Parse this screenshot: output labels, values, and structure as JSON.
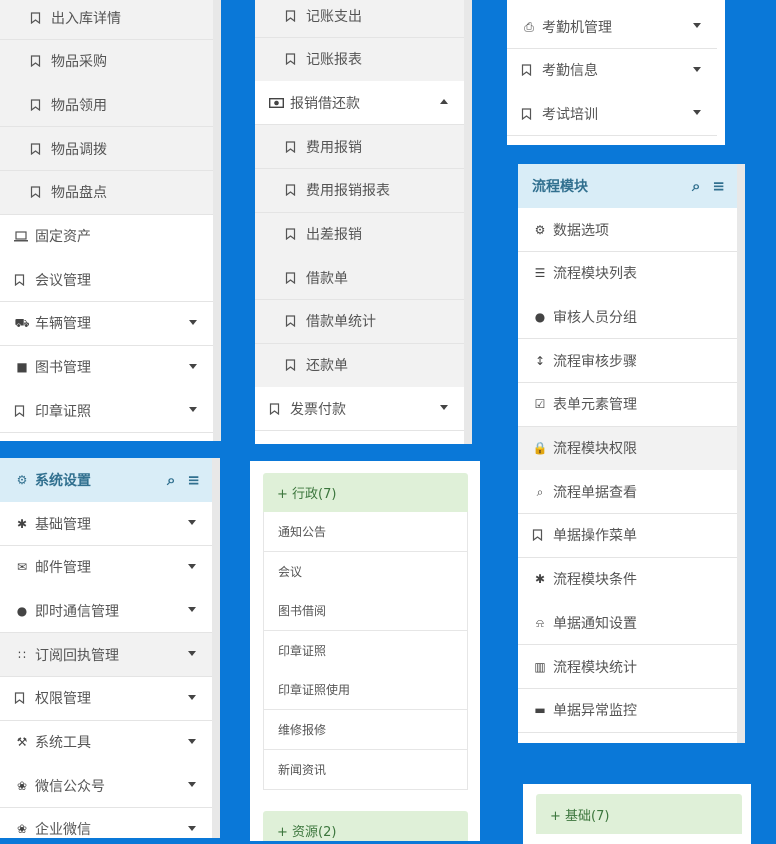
{
  "colors": {
    "background": "#0a78d8",
    "header_blue": "#d9edf7",
    "header_blue_text": "#31708f",
    "header_green": "#dff0d8",
    "header_green_text": "#3c763d"
  },
  "panel_stock": {
    "items": [
      {
        "label": "出入库详情",
        "icon": "bookmark-icon",
        "level": "sub"
      },
      {
        "label": "物品采购",
        "icon": "bookmark-icon",
        "level": "sub"
      },
      {
        "label": "物品领用",
        "icon": "bookmark-icon",
        "level": "sub"
      },
      {
        "label": "物品调拨",
        "icon": "bookmark-icon",
        "level": "sub"
      },
      {
        "label": "物品盘点",
        "icon": "bookmark-icon",
        "level": "sub"
      },
      {
        "label": "固定资产",
        "icon": "laptop-icon",
        "level": "top"
      },
      {
        "label": "会议管理",
        "icon": "bookmark-icon",
        "level": "top"
      },
      {
        "label": "车辆管理",
        "icon": "truck-icon",
        "level": "top",
        "caret": "down"
      },
      {
        "label": "图书管理",
        "icon": "book-icon",
        "level": "top",
        "caret": "down"
      },
      {
        "label": "印章证照",
        "icon": "bookmark-icon",
        "level": "top",
        "caret": "down"
      }
    ]
  },
  "panel_finance": {
    "items": [
      {
        "label": "记账支出",
        "icon": "bookmark-icon",
        "level": "sub"
      },
      {
        "label": "记账报表",
        "icon": "bookmark-icon",
        "level": "sub"
      },
      {
        "label": "报销借还款",
        "icon": "money-icon",
        "level": "top",
        "caret": "up"
      },
      {
        "label": "费用报销",
        "icon": "bookmark-icon",
        "level": "sub"
      },
      {
        "label": "费用报销报表",
        "icon": "bookmark-icon",
        "level": "sub"
      },
      {
        "label": "出差报销",
        "icon": "bookmark-icon",
        "level": "sub"
      },
      {
        "label": "借款单",
        "icon": "bookmark-icon",
        "level": "sub"
      },
      {
        "label": "借款单统计",
        "icon": "bookmark-icon",
        "level": "sub"
      },
      {
        "label": "还款单",
        "icon": "bookmark-icon",
        "level": "sub"
      },
      {
        "label": "发票付款",
        "icon": "bookmark-icon",
        "level": "top",
        "caret": "down"
      }
    ]
  },
  "panel_attendance": {
    "items": [
      {
        "label": "考勤机管理",
        "icon": "print-icon",
        "level": "top",
        "caret": "down"
      },
      {
        "label": "考勤信息",
        "icon": "bookmark-icon",
        "level": "top",
        "caret": "down"
      },
      {
        "label": "考试培训",
        "icon": "bookmark-icon",
        "level": "top",
        "caret": "down"
      }
    ]
  },
  "panel_flow": {
    "title": "流程模块",
    "items": [
      {
        "label": "数据选项",
        "icon": "gear-icon",
        "level": "top"
      },
      {
        "label": "流程模块列表",
        "icon": "list-icon",
        "level": "top"
      },
      {
        "label": "审核人员分组",
        "icon": "users-icon",
        "level": "top"
      },
      {
        "label": "流程审核步骤",
        "icon": "resize-vertical-icon",
        "level": "top"
      },
      {
        "label": "表单元素管理",
        "icon": "checkbox-icon",
        "level": "top"
      },
      {
        "label": "流程模块权限",
        "icon": "lock-icon",
        "level": "top",
        "gray": true
      },
      {
        "label": "流程单据查看",
        "icon": "search-icon",
        "level": "top"
      },
      {
        "label": "单据操作菜单",
        "icon": "bookmark-icon",
        "level": "top"
      },
      {
        "label": "流程模块条件",
        "icon": "asterisk-icon",
        "level": "top"
      },
      {
        "label": "单据通知设置",
        "icon": "bell-icon",
        "level": "top"
      },
      {
        "label": "流程模块统计",
        "icon": "bar-chart-icon",
        "level": "top"
      },
      {
        "label": "单据异常监控",
        "icon": "briefcase-icon",
        "level": "top"
      }
    ]
  },
  "panel_system": {
    "title": "系统设置",
    "items": [
      {
        "label": "基础管理",
        "icon": "asterisk-icon",
        "level": "top",
        "caret": "down"
      },
      {
        "label": "邮件管理",
        "icon": "envelope-icon",
        "level": "top",
        "caret": "down"
      },
      {
        "label": "即时通信管理",
        "icon": "comment-icon",
        "level": "top",
        "caret": "down"
      },
      {
        "label": "订阅回执管理",
        "icon": "rss-icon",
        "level": "top",
        "caret": "down",
        "gray": true
      },
      {
        "label": "权限管理",
        "icon": "bookmark-icon",
        "level": "top",
        "caret": "down"
      },
      {
        "label": "系统工具",
        "icon": "wrench-icon",
        "level": "top",
        "caret": "down"
      },
      {
        "label": "微信公众号",
        "icon": "comments-icon",
        "level": "top",
        "caret": "down"
      },
      {
        "label": "企业微信",
        "icon": "comments-icon",
        "level": "top",
        "caret": "down"
      }
    ]
  },
  "panel_groups": {
    "group1": {
      "title": "+ 行政(7)",
      "items": [
        "通知公告",
        "会议",
        "图书借阅",
        "印章证照",
        "印章证照使用",
        "维修报修",
        "新闻资讯"
      ]
    },
    "group2": {
      "title": "+ 资源(2)"
    }
  },
  "panel_basic": {
    "group": {
      "title": "+ 基础(7)"
    }
  }
}
